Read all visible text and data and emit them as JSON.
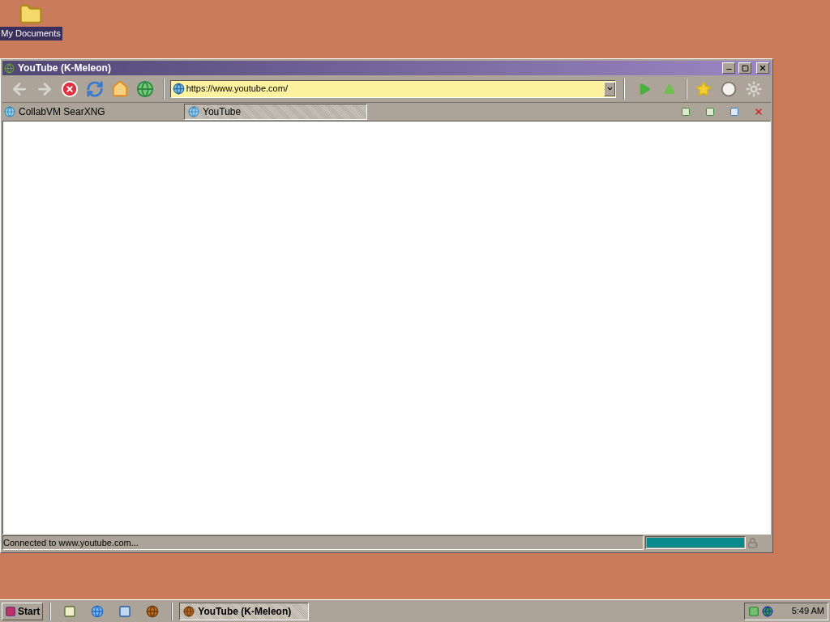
{
  "desktop_icons": [
    {
      "label": "My Documents",
      "selected": true
    }
  ],
  "window": {
    "title": "YouTube (K-Meleon)",
    "address": "https://www.youtube.com/",
    "tabs": [
      {
        "label": "CollabVM SearXNG",
        "selected": false
      },
      {
        "label": "YouTube",
        "selected": true
      }
    ],
    "status_bar": {
      "text": "Connected to www.youtube.com...",
      "level": 1
    }
  },
  "taskbar": {
    "start": "Start",
    "tasks": [
      {
        "label": "YouTube (K-Meleon)",
        "selected": true
      }
    ],
    "clock": "5:49 AM"
  }
}
